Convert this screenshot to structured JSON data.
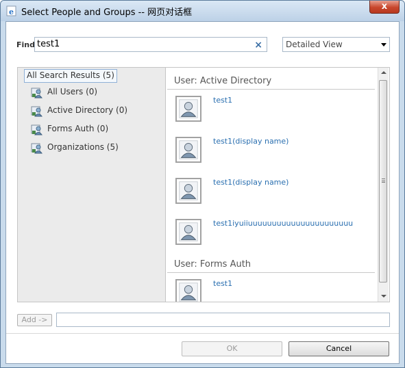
{
  "window": {
    "title": "Select People and Groups -- 网页对话框",
    "close_label": "x"
  },
  "find": {
    "label": "Find",
    "value": "test1",
    "clear_glyph": "×"
  },
  "view_select": {
    "selected": "Detailed View"
  },
  "tree": {
    "root_label": "All Search Results (5)",
    "items": [
      {
        "label": "All Users (0)",
        "icon": "users-group-icon"
      },
      {
        "label": "Active Directory (0)",
        "icon": "users-group-icon"
      },
      {
        "label": "Forms Auth (0)",
        "icon": "users-group-icon"
      },
      {
        "label": "Organizations (5)",
        "icon": "users-group-icon"
      }
    ]
  },
  "results": {
    "sections": [
      {
        "header": "User: Active Directory"
      },
      {
        "header": "User: Forms Auth"
      }
    ],
    "people": [
      {
        "name": "test1",
        "icon": "user-avatar-icon"
      },
      {
        "name": "test1(display name)",
        "icon": "user-avatar-icon"
      },
      {
        "name": "test1(display name)",
        "icon": "user-avatar-icon"
      },
      {
        "name": "test1iyuiiuuuuuuuuuuuuuuuuuuuuuu",
        "icon": "user-avatar-icon"
      },
      {
        "name": "test1",
        "icon": "user-avatar-icon"
      }
    ]
  },
  "footer": {
    "add_label": "Add ->",
    "add_value": "",
    "ok_label": "OK",
    "cancel_label": "Cancel"
  },
  "colors": {
    "titlebar": "#c9dbec",
    "link": "#2a6fb0",
    "close": "#c8462c",
    "pane_bg": "#ebebeb"
  }
}
